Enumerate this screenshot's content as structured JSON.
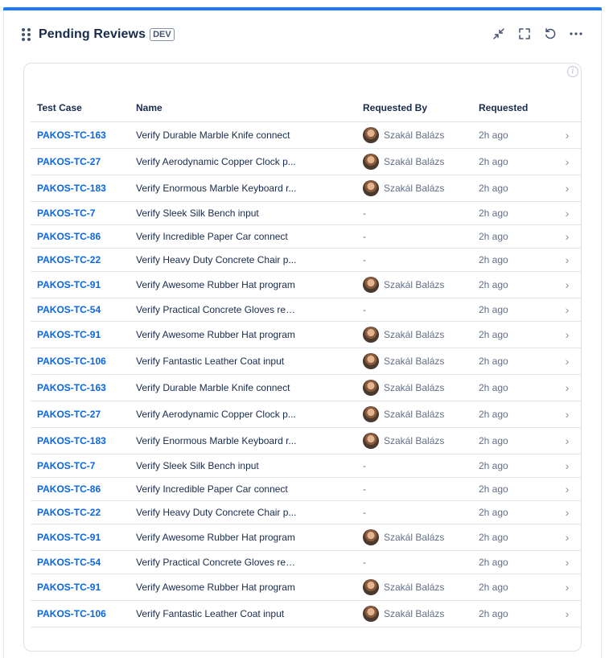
{
  "widget": {
    "title": "Pending Reviews",
    "env_badge": "DEV",
    "actions": [
      {
        "name": "collapse-icon"
      },
      {
        "name": "fullscreen-icon"
      },
      {
        "name": "refresh-icon"
      },
      {
        "name": "more-options-icon"
      }
    ],
    "accent_color": "#1d7afc"
  },
  "table": {
    "headers": {
      "test_case": "Test Case",
      "name": "Name",
      "requested_by": "Requested By",
      "requested": "Requested"
    },
    "rows": [
      {
        "key": "PAKOS-TC-163",
        "name": "Verify Durable Marble Knife connect",
        "requester": "Szakál Balázs",
        "when": "2h ago"
      },
      {
        "key": "PAKOS-TC-27",
        "name": "Verify Aerodynamic Copper Clock p...",
        "requester": "Szakál Balázs",
        "when": "2h ago"
      },
      {
        "key": "PAKOS-TC-183",
        "name": "Verify Enormous Marble Keyboard r...",
        "requester": "Szakál Balázs",
        "when": "2h ago"
      },
      {
        "key": "PAKOS-TC-7",
        "name": "Verify Sleek Silk Bench input",
        "requester": "-",
        "when": "2h ago"
      },
      {
        "key": "PAKOS-TC-86",
        "name": "Verify Incredible Paper Car connect",
        "requester": "-",
        "when": "2h ago"
      },
      {
        "key": "PAKOS-TC-22",
        "name": "Verify Heavy Duty Concrete Chair p...",
        "requester": "-",
        "when": "2h ago"
      },
      {
        "key": "PAKOS-TC-91",
        "name": "Verify Awesome Rubber Hat program",
        "requester": "Szakál Balázs",
        "when": "2h ago"
      },
      {
        "key": "PAKOS-TC-54",
        "name": "Verify Practical Concrete Gloves reb...",
        "requester": "-",
        "when": "2h ago"
      },
      {
        "key": "PAKOS-TC-91",
        "name": "Verify Awesome Rubber Hat program",
        "requester": "Szakál Balázs",
        "when": "2h ago"
      },
      {
        "key": "PAKOS-TC-106",
        "name": "Verify Fantastic Leather Coat input",
        "requester": "Szakál Balázs",
        "when": "2h ago"
      },
      {
        "key": "PAKOS-TC-163",
        "name": "Verify Durable Marble Knife connect",
        "requester": "Szakál Balázs",
        "when": "2h ago"
      },
      {
        "key": "PAKOS-TC-27",
        "name": "Verify Aerodynamic Copper Clock p...",
        "requester": "Szakál Balázs",
        "when": "2h ago"
      },
      {
        "key": "PAKOS-TC-183",
        "name": "Verify Enormous Marble Keyboard r...",
        "requester": "Szakál Balázs",
        "when": "2h ago"
      },
      {
        "key": "PAKOS-TC-7",
        "name": "Verify Sleek Silk Bench input",
        "requester": "-",
        "when": "2h ago"
      },
      {
        "key": "PAKOS-TC-86",
        "name": "Verify Incredible Paper Car connect",
        "requester": "-",
        "when": "2h ago"
      },
      {
        "key": "PAKOS-TC-22",
        "name": "Verify Heavy Duty Concrete Chair p...",
        "requester": "-",
        "when": "2h ago"
      },
      {
        "key": "PAKOS-TC-91",
        "name": "Verify Awesome Rubber Hat program",
        "requester": "Szakál Balázs",
        "when": "2h ago"
      },
      {
        "key": "PAKOS-TC-54",
        "name": "Verify Practical Concrete Gloves reb...",
        "requester": "-",
        "when": "2h ago"
      },
      {
        "key": "PAKOS-TC-91",
        "name": "Verify Awesome Rubber Hat program",
        "requester": "Szakál Balázs",
        "when": "2h ago"
      },
      {
        "key": "PAKOS-TC-106",
        "name": "Verify Fantastic Leather Coat input",
        "requester": "Szakál Balázs",
        "when": "2h ago"
      }
    ]
  }
}
